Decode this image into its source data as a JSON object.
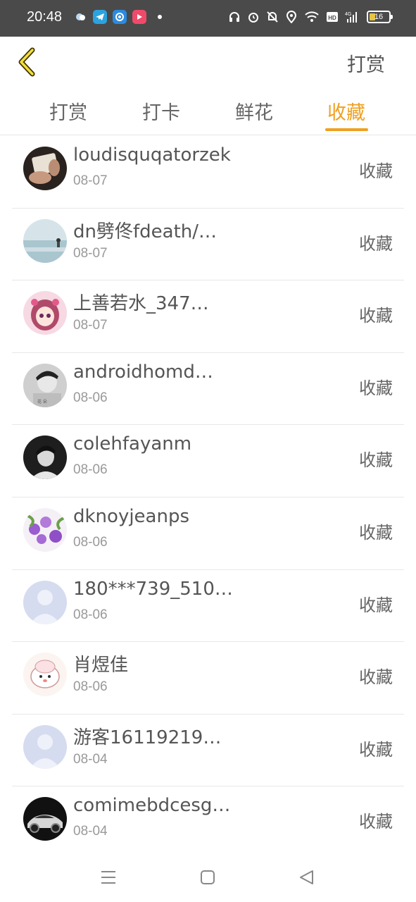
{
  "status_bar": {
    "time": "20:48",
    "battery_level": "16",
    "battery_fraction": 0.16,
    "left_icons": [
      "weather-icon",
      "telegram-icon",
      "browser-icon",
      "video-app-icon",
      "dot-icon"
    ],
    "right_icons": [
      "headphones-icon",
      "alarm-icon",
      "mute-bell-icon",
      "location-icon",
      "wifi-icon",
      "hd-icon",
      "signal-4g-icon"
    ]
  },
  "header": {
    "right_title": "打赏"
  },
  "tabs": [
    {
      "label": "打赏",
      "active": false
    },
    {
      "label": "打卡",
      "active": false
    },
    {
      "label": "鲜花",
      "active": false
    },
    {
      "label": "收藏",
      "active": true
    }
  ],
  "colors": {
    "accent": "#f0a020",
    "status_bar": "#4a4a4a"
  },
  "list": [
    {
      "name": "loudisquqatorzek",
      "date": "08-07",
      "action": "收藏",
      "avatar": "photo-hands"
    },
    {
      "name": "dn劈佟fdeath/…",
      "date": "08-07",
      "action": "收藏",
      "avatar": "photo-sea"
    },
    {
      "name": "上善若水_347…",
      "date": "08-07",
      "action": "收藏",
      "avatar": "anime-girl"
    },
    {
      "name": "androidhomd…",
      "date": "08-06",
      "action": "收藏",
      "avatar": "photo-boy-bw"
    },
    {
      "name": "colehfayanm",
      "date": "08-06",
      "action": "收藏",
      "avatar": "photo-man-bw"
    },
    {
      "name": "dknoyjeanps",
      "date": "08-06",
      "action": "收藏",
      "avatar": "photo-flowers"
    },
    {
      "name": "180***739_510…",
      "date": "08-06",
      "action": "收藏",
      "avatar": "default-person"
    },
    {
      "name": "肖煜佳",
      "date": "08-06",
      "action": "收藏",
      "avatar": "cartoon-cute"
    },
    {
      "name": "游客16119219…",
      "date": "08-04",
      "action": "收藏",
      "avatar": "default-person"
    },
    {
      "name": "comimebdcesg…",
      "date": "08-04",
      "action": "收藏",
      "avatar": "photo-car"
    }
  ],
  "nav_bar": [
    "menu-icon",
    "home-icon",
    "back-triangle-icon"
  ]
}
